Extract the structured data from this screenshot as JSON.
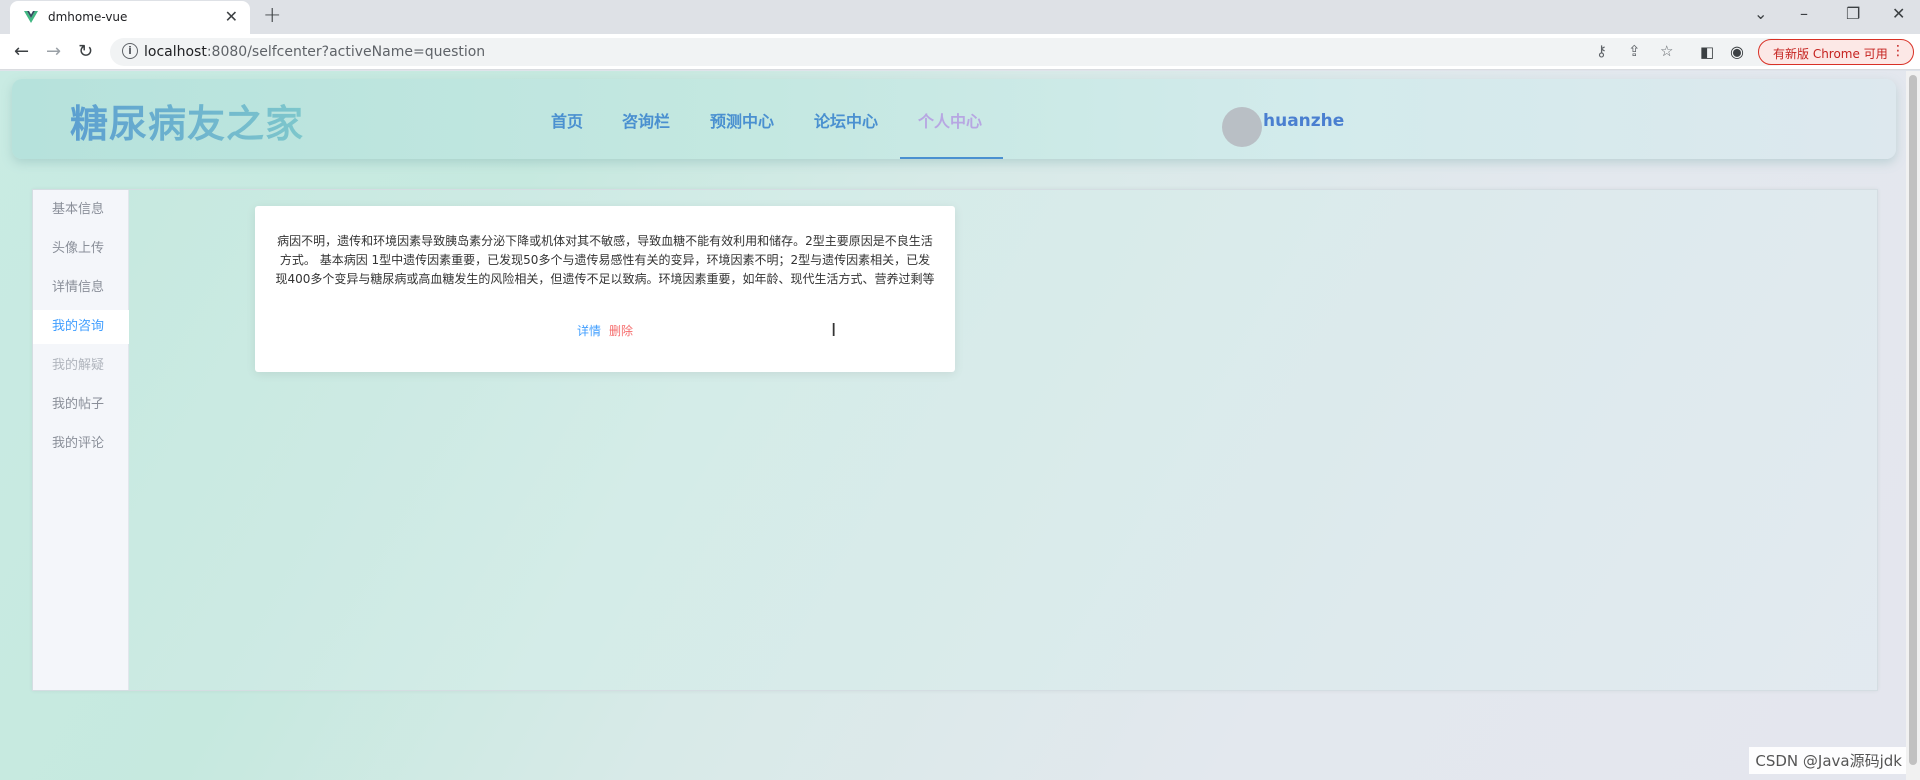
{
  "browser": {
    "tab_title": "dmhome-vue",
    "tab_close": "✕",
    "new_tab": "+",
    "url_host": "localhost",
    "url_path": ":8080/selfcenter?activeName=question",
    "update_label": "有新版 Chrome 可用",
    "window_controls": [
      "⌄",
      "–",
      "❐",
      "✕"
    ]
  },
  "header": {
    "logo": "糖尿病友之家",
    "nav": [
      "首页",
      "咨询栏",
      "预测中心",
      "论坛中心",
      "个人中心"
    ],
    "active_nav": "个人中心",
    "username": "huanzhe"
  },
  "sidebar": {
    "items": [
      "基本信息",
      "头像上传",
      "详情信息",
      "我的咨询",
      "我的解疑",
      "我的帖子",
      "我的评论"
    ],
    "active": "我的咨询"
  },
  "question_card": {
    "text": "病因不明，遗传和环境因素导致胰岛素分泌下降或机体对其不敏感，导致血糖不能有效利用和储存。2型主要原因是不良生活方式。 基本病因 1型中遗传因素重要，已发现50多个与遗传易感性有关的变异，环境因素不明；2型与遗传因素相关，已发现400多个变异与糖尿病或高血糖发生的风险相关，但遗传不足以致病。环境因素重要，如年龄、现代生活方式、营养过剩等",
    "detail_label": "详情",
    "delete_label": "删除"
  },
  "watermark": "CSDN @Java源码jdk"
}
